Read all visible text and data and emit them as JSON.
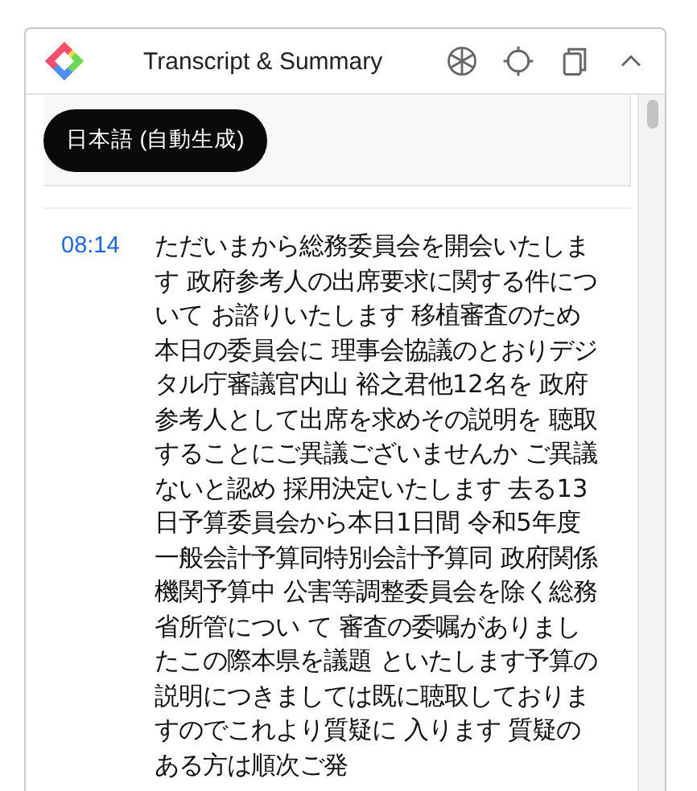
{
  "panel": {
    "title": "Transcript & Summary"
  },
  "language_chip": {
    "label": "日本語 (自動生成)"
  },
  "segments": [
    {
      "time": "08:14",
      "text": "ただいまから総務委員会を開会いたします 政府参考人の出席要求に関する件について お諮りいたします 移植審査のため本日の委員会に 理事会協議のとおりデジタル庁審議官内山 裕之君他12名を 政府参考人として出席を求めその説明を 聴取することにご異議ございませんか ご異議ないと認め 採用決定いたします 去る13日予算委員会から本日1日間 令和5年度一般会計予算同特別会計予算同 政府関係機関予算中 公害等調整委員会を除く総務省所管につい て 審査の委嘱がありましたこの際本県を議題 といたします予算の説明につきましては既に聴取しておりますのでこれより質疑に 入ります 質疑のある方は順次ご発"
    }
  ]
}
